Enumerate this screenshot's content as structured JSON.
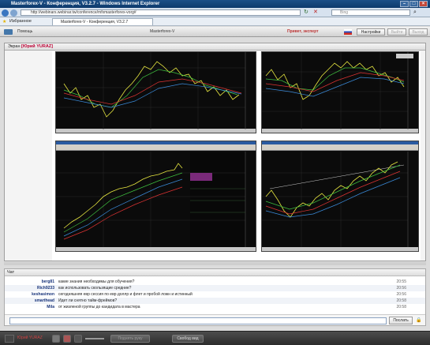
{
  "window": {
    "title": "Masterforex-V - Конференция, V3.2.7 - Windows Internet Explorer"
  },
  "browser": {
    "address": "http://webinars.webinar.tw/conference/mfxmasterforex-vorg#",
    "search_placeholder": "Bing",
    "favorites_label": "Избранное",
    "tab_label": "Masterforex-V - Конференция, V3.2.7"
  },
  "app": {
    "help_label": "Помощь",
    "title": "Masterforex-V",
    "greeting": "Привет, эксперт",
    "buttons": {
      "settings": "Настройки",
      "exit": "Выйти",
      "quit": "Выход"
    }
  },
  "screen": {
    "label": "Экран",
    "presenter": "[Юрий YURAZ]"
  },
  "chat": {
    "label": "Чат",
    "messages": [
      {
        "user": "berg81",
        "text": "какие знания необходимы для обучения?",
        "time": "20:55"
      },
      {
        "user": "Rich9233",
        "text": "как использовать скользящие средние?",
        "time": "20:56"
      },
      {
        "user": "keshasimon",
        "text": "сегодняшняя евр сессия по евр доллр и флет и пробой ложн и истинный",
        "time": "20:56"
      },
      {
        "user": "smarthead",
        "text": "Идет ли снятно тайм-фреймов?",
        "time": "20:58"
      },
      {
        "user": "Mila",
        "text": "от жизленой группы до кандидата в мастера",
        "time": "20:58"
      }
    ],
    "send_label": "Послать"
  },
  "bottom": {
    "user": "Юрий YURAZ",
    "raise_hand": "Поднять руку",
    "free_mode": "Свобод вид"
  }
}
